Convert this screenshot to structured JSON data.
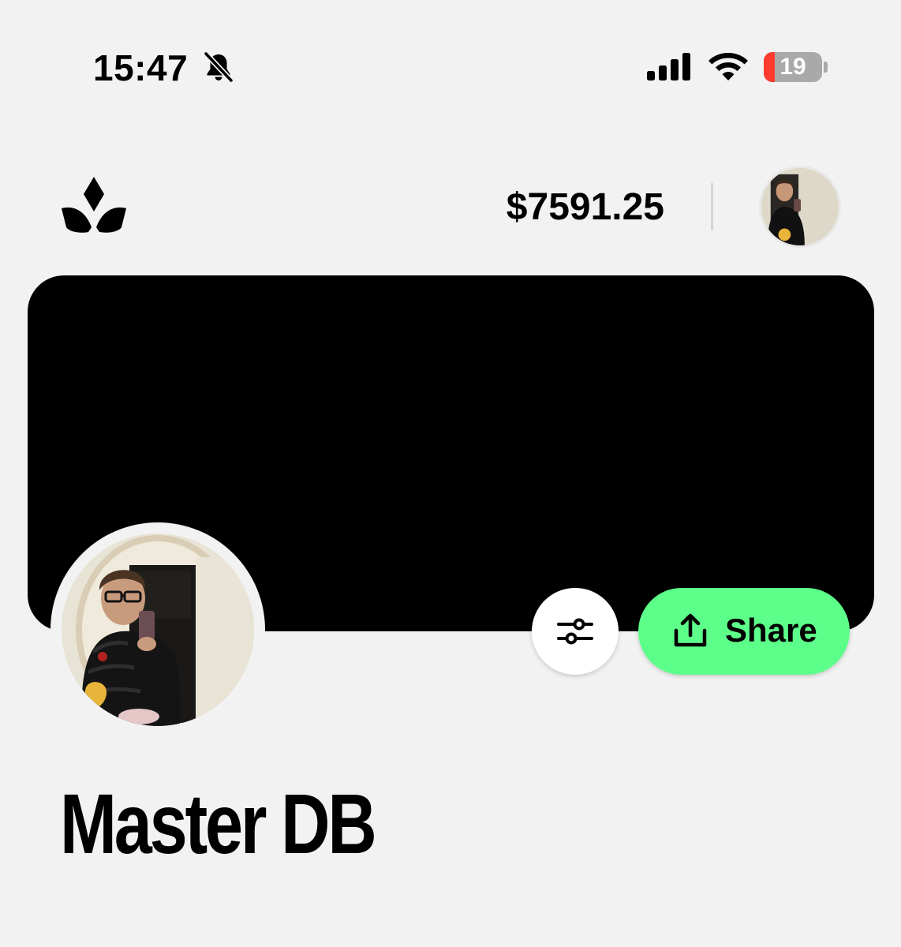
{
  "status_bar": {
    "time": "15:47",
    "battery_percent": "19",
    "battery_level": 0.19,
    "icons": [
      "bell-slash-icon",
      "cellular-signal-icon",
      "wifi-icon",
      "battery-icon"
    ]
  },
  "header": {
    "logo_icon": "crown-icon",
    "balance": "$7591.25",
    "avatar_icon": "profile-avatar-icon"
  },
  "banner": {
    "color": "#000000"
  },
  "profile": {
    "name": "Master DB",
    "avatar_icon": "profile-photo"
  },
  "actions": {
    "filter_icon": "sliders-icon",
    "share_label": "Share",
    "share_icon": "share-upload-icon",
    "share_color": "#5dff8b"
  }
}
